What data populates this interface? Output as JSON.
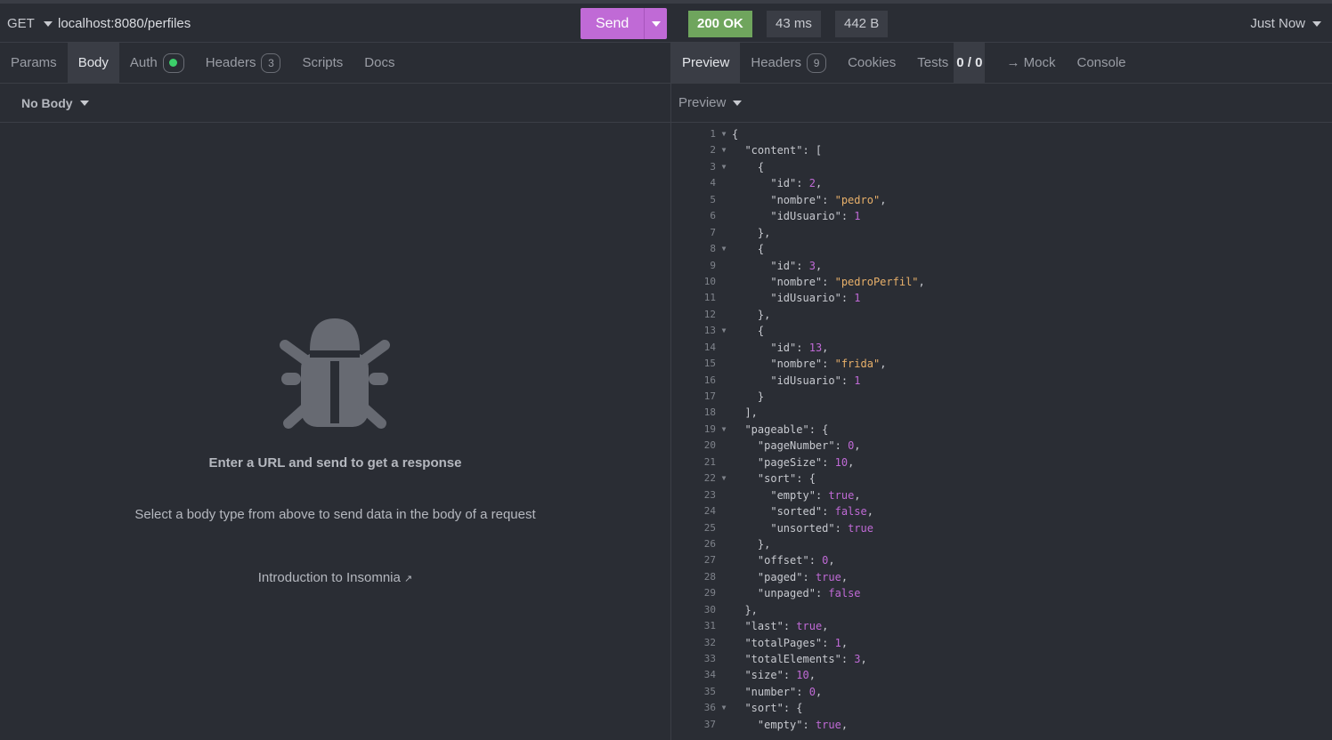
{
  "request": {
    "method": "GET",
    "url": "localhost:8080/perfiles",
    "send_label": "Send"
  },
  "response_meta": {
    "status": "200 OK",
    "time": "43 ms",
    "size": "442 B",
    "history": "Just Now"
  },
  "request_tabs": [
    {
      "label": "Params"
    },
    {
      "label": "Body"
    },
    {
      "label": "Auth"
    },
    {
      "label": "Headers",
      "badge": "3"
    },
    {
      "label": "Scripts"
    },
    {
      "label": "Docs"
    }
  ],
  "response_tabs": [
    {
      "label": "Preview"
    },
    {
      "label": "Headers",
      "badge": "9"
    },
    {
      "label": "Cookies"
    },
    {
      "label": "Tests",
      "value": "0 / 0"
    },
    {
      "label": "→ Mock"
    },
    {
      "label": "Console"
    }
  ],
  "body_type": "No Body",
  "preview_mode": "Preview",
  "empty_state": {
    "title": "Enter a URL and send to get a response",
    "subtitle": "Select a body type from above to send data in the body of a request",
    "link": "Introduction to Insomnia",
    "link_icon": "external-link-icon"
  },
  "colors": {
    "accent": "#c06ad6",
    "status_ok": "#6fa55d",
    "string": "#e8b06a",
    "number": "#c06ad6"
  },
  "code_lines": [
    {
      "n": "1",
      "fold": true,
      "t": "{"
    },
    {
      "n": "2",
      "fold": true,
      "t": "  \"content\": ["
    },
    {
      "n": "3",
      "fold": true,
      "t": "    {"
    },
    {
      "n": "4",
      "t": "      \"id\": 2,"
    },
    {
      "n": "5",
      "t": "      \"nombre\": \"pedro\","
    },
    {
      "n": "6",
      "t": "      \"idUsuario\": 1"
    },
    {
      "n": "7",
      "t": "    },"
    },
    {
      "n": "8",
      "fold": true,
      "t": "    {"
    },
    {
      "n": "9",
      "t": "      \"id\": 3,"
    },
    {
      "n": "10",
      "t": "      \"nombre\": \"pedroPerfil\","
    },
    {
      "n": "11",
      "t": "      \"idUsuario\": 1"
    },
    {
      "n": "12",
      "t": "    },"
    },
    {
      "n": "13",
      "fold": true,
      "t": "    {"
    },
    {
      "n": "14",
      "t": "      \"id\": 13,"
    },
    {
      "n": "15",
      "t": "      \"nombre\": \"frida\","
    },
    {
      "n": "16",
      "t": "      \"idUsuario\": 1"
    },
    {
      "n": "17",
      "t": "    }"
    },
    {
      "n": "18",
      "t": "  ],"
    },
    {
      "n": "19",
      "fold": true,
      "t": "  \"pageable\": {"
    },
    {
      "n": "20",
      "t": "    \"pageNumber\": 0,"
    },
    {
      "n": "21",
      "t": "    \"pageSize\": 10,"
    },
    {
      "n": "22",
      "fold": true,
      "t": "    \"sort\": {"
    },
    {
      "n": "23",
      "t": "      \"empty\": true,"
    },
    {
      "n": "24",
      "t": "      \"sorted\": false,"
    },
    {
      "n": "25",
      "t": "      \"unsorted\": true"
    },
    {
      "n": "26",
      "t": "    },"
    },
    {
      "n": "27",
      "t": "    \"offset\": 0,"
    },
    {
      "n": "28",
      "t": "    \"paged\": true,"
    },
    {
      "n": "29",
      "t": "    \"unpaged\": false"
    },
    {
      "n": "30",
      "t": "  },"
    },
    {
      "n": "31",
      "t": "  \"last\": true,"
    },
    {
      "n": "32",
      "t": "  \"totalPages\": 1,"
    },
    {
      "n": "33",
      "t": "  \"totalElements\": 3,"
    },
    {
      "n": "34",
      "t": "  \"size\": 10,"
    },
    {
      "n": "35",
      "t": "  \"number\": 0,"
    },
    {
      "n": "36",
      "fold": true,
      "t": "  \"sort\": {"
    },
    {
      "n": "37",
      "t": "    \"empty\": true,"
    }
  ]
}
